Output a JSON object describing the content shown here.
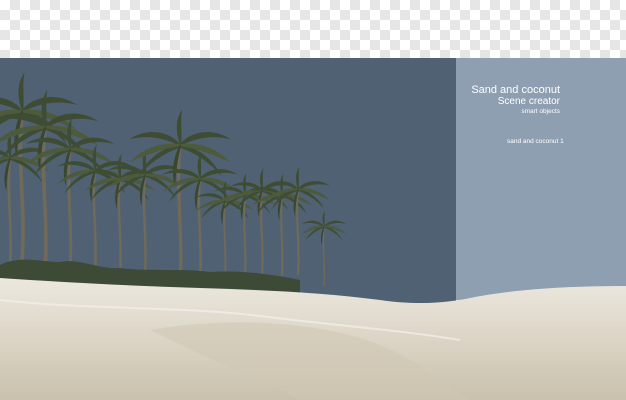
{
  "panel": {
    "title": "Sand and coconut",
    "subtitle": "Scene creator",
    "caption": "smart objects",
    "label": "sand and coconut 1"
  },
  "colors": {
    "sky": "#4f6173",
    "panel": "#8e9fb1",
    "sand": "#e8e2d4",
    "foliage": "#3d4a36"
  },
  "scene": {
    "elements": [
      "palm-tree",
      "sand-dune",
      "grass-shrubs",
      "transparency-checkerboard"
    ]
  }
}
